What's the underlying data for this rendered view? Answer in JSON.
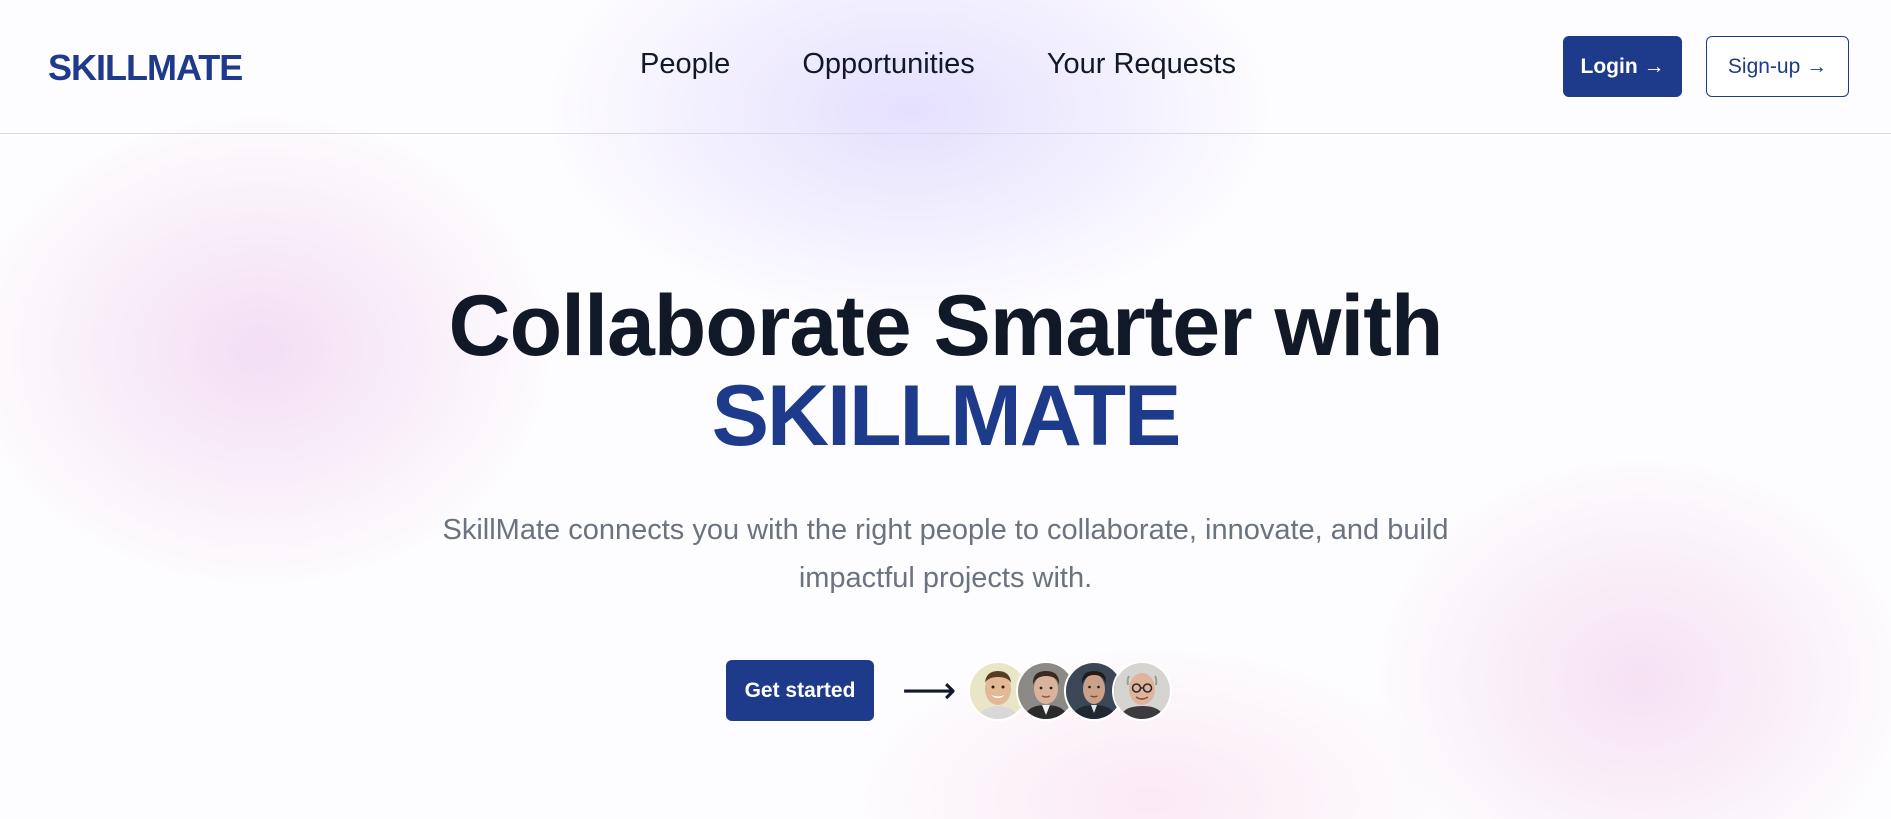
{
  "header": {
    "logo": "SKILLMATE",
    "nav": [
      {
        "label": "People"
      },
      {
        "label": "Opportunities"
      },
      {
        "label": "Your Requests"
      }
    ],
    "login_label": "Login →",
    "signup_label": "Sign-up →"
  },
  "hero": {
    "title_line1": "Collaborate Smarter with",
    "title_line2": "SKILLMATE",
    "subtitle": "SkillMate connects you with the right people to collaborate, innovate, and build impactful projects with.",
    "cta_label": "Get started",
    "arrow": "⟶",
    "avatars": [
      {
        "icon": "avatar-photo-1"
      },
      {
        "icon": "avatar-photo-2"
      },
      {
        "icon": "avatar-photo-3"
      },
      {
        "icon": "avatar-photo-4"
      }
    ]
  },
  "colors": {
    "brand": "#1e3a8a",
    "text": "#111827",
    "muted": "#6b7280"
  }
}
